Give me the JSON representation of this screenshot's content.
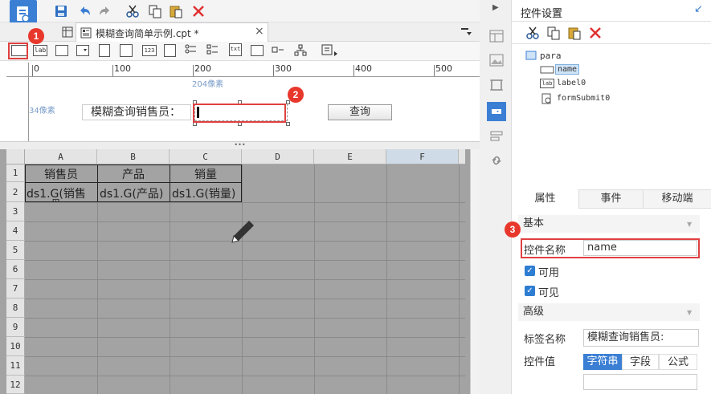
{
  "tab": {
    "title": "模糊查询简单示例.cpt *",
    "close": "×"
  },
  "widget_toolbar": {
    "label_btn": "lab",
    "number_btn": "123",
    "text_btn": "txt"
  },
  "ruler": {
    "marks": [
      "0",
      "100",
      "200",
      "300",
      "400",
      "500"
    ],
    "pixel_hint_x": "204像素",
    "pixel_hint_y": "34像素"
  },
  "para": {
    "label_text": "模糊查询销售员：",
    "button_label": "查询"
  },
  "sheet": {
    "columns": [
      "A",
      "B",
      "C",
      "D",
      "E",
      "F"
    ],
    "rows": [
      "1",
      "2",
      "3",
      "4",
      "5",
      "6",
      "7",
      "8",
      "9",
      "10",
      "11",
      "12"
    ],
    "header_row": [
      "销售员",
      "产品",
      "销量"
    ],
    "data_row": [
      "ds1.G(销售",
      "ds1.G(产品)",
      "ds1.G(销量)"
    ],
    "data_row_overflow": "员"
  },
  "right_panel": {
    "title": "控件设置",
    "tree": {
      "root": "para",
      "items": [
        "name",
        "label0",
        "formSubmit0"
      ]
    },
    "tabs": [
      "属性",
      "事件",
      "移动端"
    ],
    "section_basic": "基本",
    "widget_name_label": "控件名称",
    "widget_name_value": "name",
    "enabled_label": "可用",
    "visible_label": "可见",
    "section_advanced": "高级",
    "tag_name_label": "标签名称",
    "tag_name_value": "模糊查询销售员:",
    "widget_value_label": "控件值",
    "value_types": [
      "字符串",
      "字段",
      "公式"
    ]
  },
  "callouts": [
    "1",
    "2",
    "3"
  ],
  "colors": {
    "accent": "#2d7dd2",
    "callout": "#e8372b",
    "sheet_bg": "#a3a3a3"
  }
}
